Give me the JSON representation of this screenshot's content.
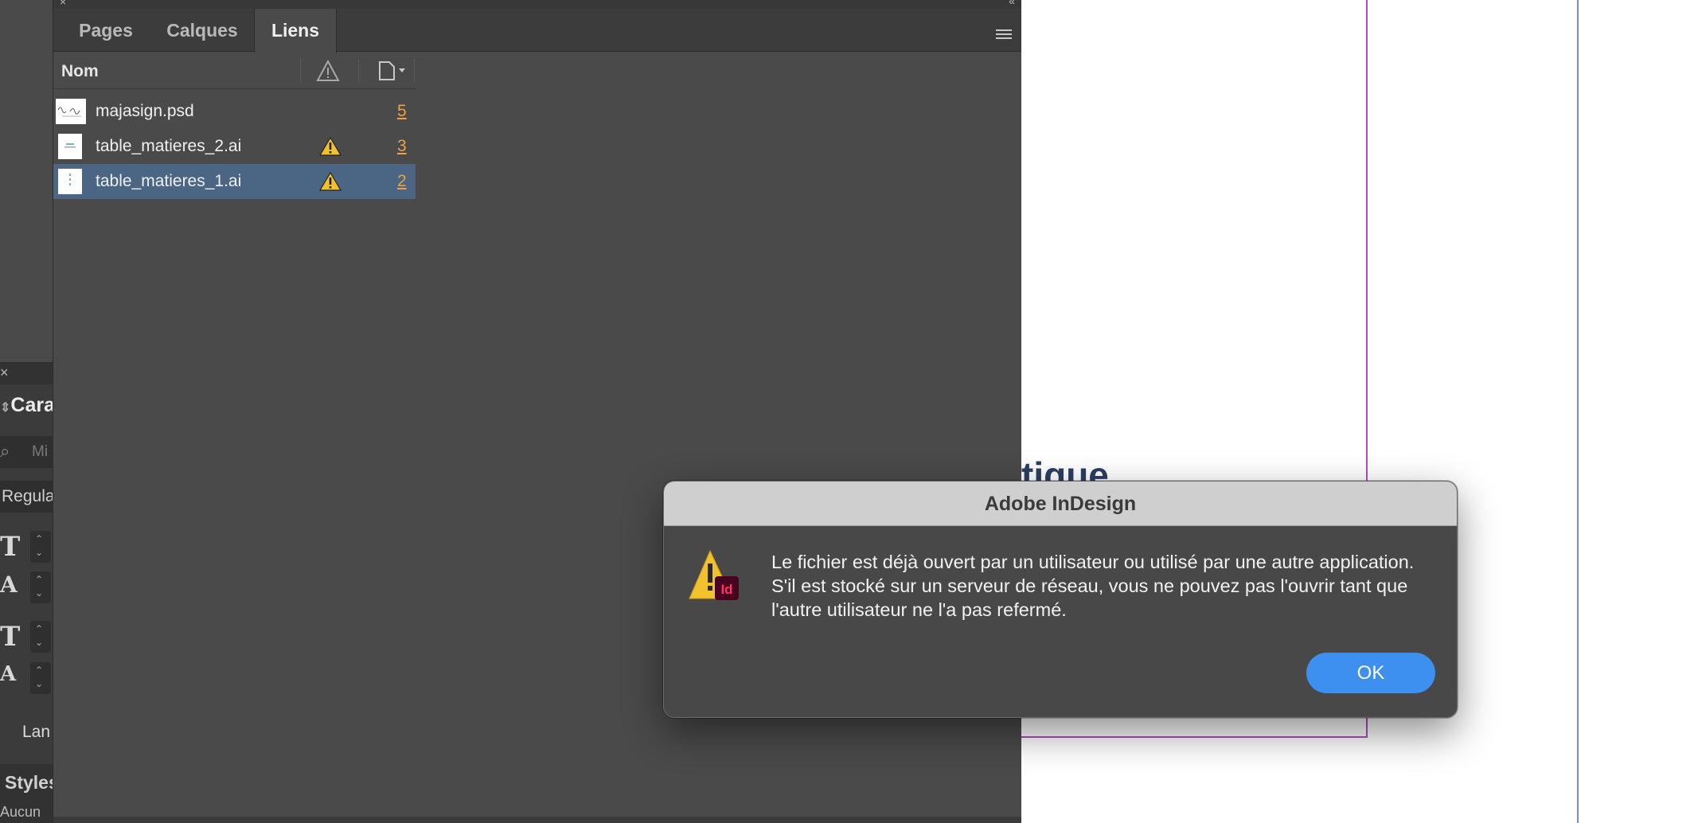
{
  "panel": {
    "tabs": [
      {
        "label": "Pages"
      },
      {
        "label": "Calques"
      },
      {
        "label": "Liens"
      }
    ],
    "active_tab": "Liens",
    "column_name_label": "Nom",
    "links": [
      {
        "name": "majasign.psd",
        "warning": false,
        "page": "5",
        "selected": false
      },
      {
        "name": "table_matieres_2.ai",
        "warning": true,
        "page": "3",
        "selected": false
      },
      {
        "name": "table_matieres_1.ai",
        "warning": true,
        "page": "2",
        "selected": true
      }
    ]
  },
  "left_panel": {
    "title_partial": "Cara",
    "search_placeholder_partial": "Mi",
    "style_partial": "Regula",
    "language_partial": "Lan",
    "styles_partial": "Styles",
    "bottom_partial": "Aucun"
  },
  "canvas": {
    "text_fragment": "tique"
  },
  "dialog": {
    "title": "Adobe InDesign",
    "message": "Le fichier est déjà ouvert par un utilisateur ou utilisé par une autre application. S'il est stocké sur un serveur de réseau, vous ne pouvez pas l'ouvrir tant que l'autre utilisateur ne l'a pas refermé.",
    "ok_label": "OK",
    "icon_badge": "Id"
  },
  "colors": {
    "panel_bg": "#4a4a4a",
    "selection": "#4b6584",
    "page_link": "#f0a142",
    "warning": "#f2c12e",
    "ok_button": "#3d8ff0",
    "indesign_badge": "#49021f"
  }
}
